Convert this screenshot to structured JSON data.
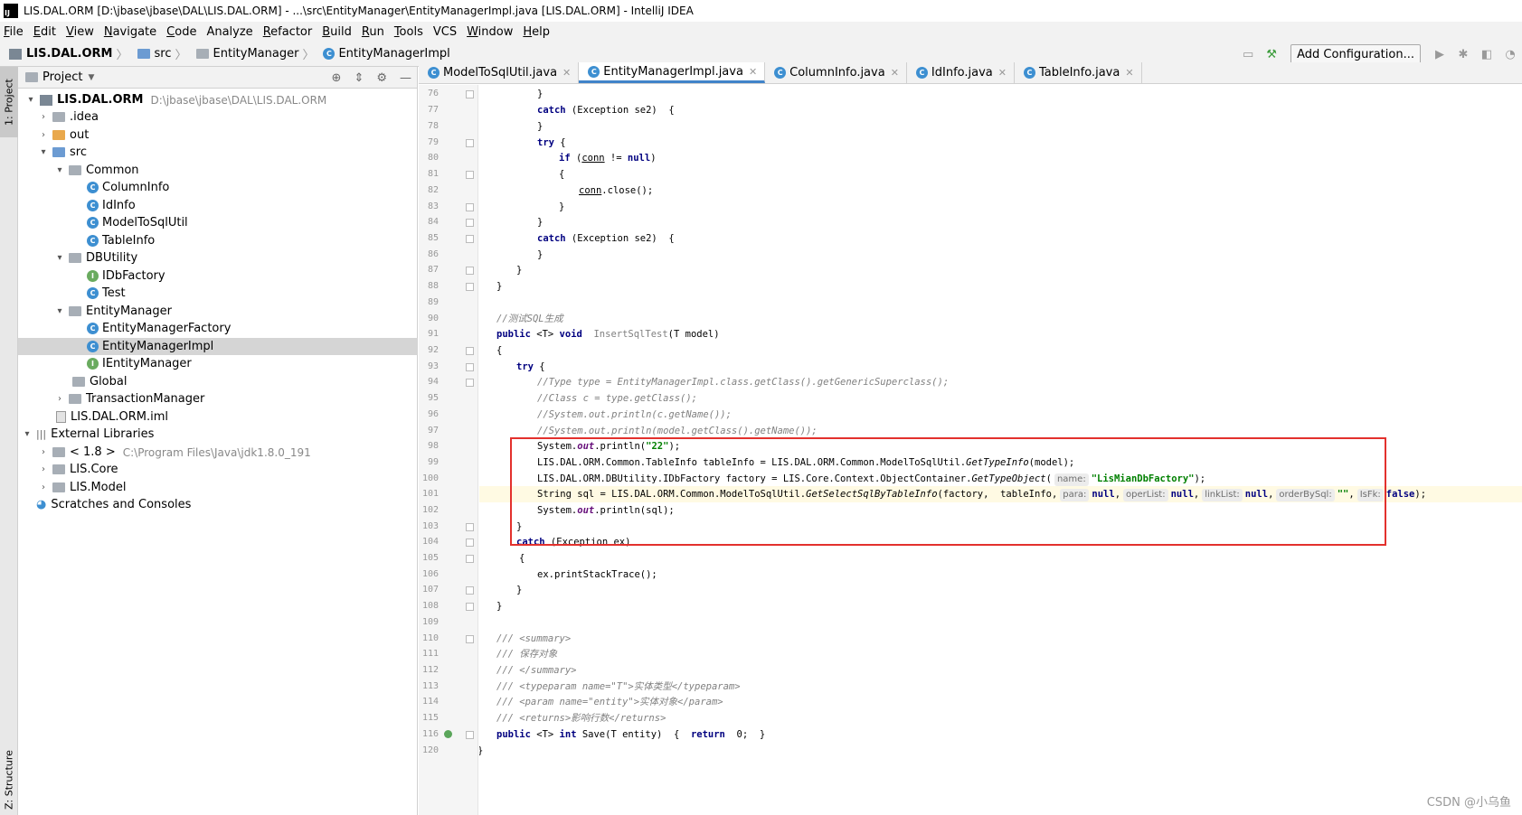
{
  "window": {
    "title": "LIS.DAL.ORM [D:\\jbase\\jbase\\DAL\\LIS.DAL.ORM] - ...\\src\\EntityManager\\EntityManagerImpl.java [LIS.DAL.ORM] - IntelliJ IDEA",
    "icon_text": "IJ"
  },
  "menu": [
    {
      "m": "F",
      "rest": "ile"
    },
    {
      "m": "E",
      "rest": "dit"
    },
    {
      "m": "V",
      "rest": "iew"
    },
    {
      "m": "N",
      "rest": "avigate"
    },
    {
      "m": "C",
      "rest": "ode"
    },
    {
      "m": "",
      "rest": "Analyze"
    },
    {
      "m": "R",
      "rest": "efactor"
    },
    {
      "m": "B",
      "rest": "uild"
    },
    {
      "m": "R",
      "rest": "un"
    },
    {
      "m": "T",
      "rest": "ools"
    },
    {
      "m": "",
      "rest": "VCS"
    },
    {
      "m": "W",
      "rest": "indow"
    },
    {
      "m": "H",
      "rest": "elp"
    }
  ],
  "breadcrumb": [
    "LIS.DAL.ORM",
    "src",
    "EntityManager",
    "EntityManagerImpl"
  ],
  "toolbar": {
    "add_configuration": "Add Configuration..."
  },
  "side_tabs": {
    "project": "1: Project",
    "structure": "Z: Structure"
  },
  "project_panel": {
    "title": "Project",
    "tree": [
      {
        "label": "LIS.DAL.ORM",
        "path": "D:\\jbase\\jbase\\DAL\\LIS.DAL.ORM",
        "icon": "module-folder-icon"
      },
      {
        "label": ".idea",
        "icon": "folder-icon"
      },
      {
        "label": "out",
        "icon": "folder-orange-icon"
      },
      {
        "label": "src",
        "icon": "folder-blue-icon"
      },
      {
        "label": "Common",
        "icon": "package-icon"
      },
      {
        "label": "ColumnInfo",
        "icon": "class-icon"
      },
      {
        "label": "IdInfo",
        "icon": "class-icon"
      },
      {
        "label": "ModelToSqlUtil",
        "icon": "class-icon"
      },
      {
        "label": "TableInfo",
        "icon": "class-icon"
      },
      {
        "label": "DBUtility",
        "icon": "package-icon"
      },
      {
        "label": "IDbFactory",
        "icon": "interface-icon"
      },
      {
        "label": "Test",
        "icon": "class-icon"
      },
      {
        "label": "EntityManager",
        "icon": "package-icon"
      },
      {
        "label": "EntityManagerFactory",
        "icon": "class-icon"
      },
      {
        "label": "EntityManagerImpl",
        "icon": "class-icon"
      },
      {
        "label": "IEntityManager",
        "icon": "interface-icon"
      },
      {
        "label": "Global",
        "icon": "package-icon"
      },
      {
        "label": "TransactionManager",
        "icon": "package-icon"
      },
      {
        "label": "LIS.DAL.ORM.iml",
        "icon": "iml-file-icon"
      },
      {
        "label": "External Libraries",
        "icon": "libraries-icon"
      },
      {
        "label": "< 1.8 >",
        "path": "C:\\Program Files\\Java\\jdk1.8.0_191",
        "icon": "jdk-icon"
      },
      {
        "label": "LIS.Core",
        "icon": "library-icon"
      },
      {
        "label": "LIS.Model",
        "icon": "library-icon"
      },
      {
        "label": "Scratches and Consoles",
        "icon": "scratches-icon"
      }
    ]
  },
  "editor_tabs": [
    {
      "label": "ModelToSqlUtil.java",
      "active": false
    },
    {
      "label": "EntityManagerImpl.java",
      "active": true
    },
    {
      "label": "ColumnInfo.java",
      "active": false
    },
    {
      "label": "IdInfo.java",
      "active": false
    },
    {
      "label": "TableInfo.java",
      "active": false
    }
  ],
  "line_numbers": [
    "76",
    "77",
    "78",
    "79",
    "80",
    "81",
    "82",
    "83",
    "84",
    "85",
    "86",
    "87",
    "88",
    "89",
    "90",
    "91",
    "92",
    "93",
    "94",
    "95",
    "96",
    "97",
    "98",
    "99",
    "100",
    "101",
    "102",
    "103",
    "104",
    "105",
    "106",
    "107",
    "108",
    "109",
    "110",
    "111",
    "112",
    "113",
    "114",
    "115",
    "116",
    "120"
  ],
  "code": {
    "l76": "}",
    "l77_kw": "catch",
    "l77": " (Exception se2)  {",
    "l78": "}",
    "l79_kw": "try",
    "l79": " {",
    "l80_kw": "if",
    "l80_a": " (",
    "l80_var": "conn",
    "l80_b": " != ",
    "l80_null": "null",
    "l80_c": ")",
    "l81": "{",
    "l82_var": "conn",
    "l82": ".close();",
    "l83": "}",
    "l84": "}",
    "l85_kw": "catch",
    "l85": " (Exception se2)  {",
    "l86": "}",
    "l87": "}",
    "l88": "}",
    "l90": "//测试SQL生成",
    "l91_kw1": "public",
    "l91_a": " <T> ",
    "l91_kw2": "void",
    "l91_fn": "  InsertSqlTest",
    "l91_b": "(T model)",
    "l92": "{",
    "l93_kw": "try",
    "l93": " {",
    "l94": "//Type type = EntityManagerImpl.class.getClass().getGenericSuperclass();",
    "l95": "//Class c = type.getClass();",
    "l96": "//System.out.println(c.getName());",
    "l97": "//System.out.println(model.getClass().getName());",
    "l98_a": "System.",
    "l98_out": "out",
    "l98_b": ".println(",
    "l98_str": "\"22\"",
    "l98_c": ");",
    "l99_a": "LIS.DAL.ORM.Common.TableInfo tableInfo = LIS.DAL.ORM.Common.ModelToSqlUtil.",
    "l99_fn": "GetTypeInfo",
    "l99_b": "(model);",
    "l100_a": "LIS.DAL.ORM.DBUtility.IDbFactory factory = LIS.Core.Context.ObjectContainer.",
    "l100_fn": "GetTypeObject",
    "l100_b": "(",
    "l100_hint": "name:",
    "l100_str": "\"LisMianDbFactory\"",
    "l100_c": ");",
    "l101_a": "String sql = LIS.DAL.ORM.Common.ModelToSqlUtil.",
    "l101_fn": "GetSelectSqlByTableInfo",
    "l101_b": "(factory,  tableInfo,",
    "l101_h1": "para:",
    "l101_null1": "null",
    "l101_h2": "operList:",
    "l101_null2": "null",
    "l101_h3": "linkList:",
    "l101_null3": "null",
    "l101_h4": "orderBySql:",
    "l101_str": "\"\"",
    "l101_h5": "IsFk:",
    "l101_false": "false",
    "l101_c": ");",
    "l102_a": "System.",
    "l102_out": "out",
    "l102_b": ".println(sql);",
    "l103": "}",
    "l104_kw": "catch",
    "l104": " (Exception ex)",
    "l105": "{",
    "l106": "ex.printStackTrace();",
    "l107": "}",
    "l108": "}",
    "l110": "/// <summary>",
    "l111": "/// 保存对象",
    "l112": "/// </summary>",
    "l113": "/// <typeparam name=\"T\">实体类型</typeparam>",
    "l114": "/// <param name=\"entity\">实体对象</param>",
    "l115": "/// <returns>影响行数</returns>",
    "l116_kw1": "public",
    "l116_a": " <T> ",
    "l116_kw2": "int",
    "l116_b": " Save(T entity)  {  ",
    "l116_kw3": "return",
    "l116_c": "  0;  }",
    "l120": "}"
  },
  "watermark": "CSDN @小乌鱼"
}
